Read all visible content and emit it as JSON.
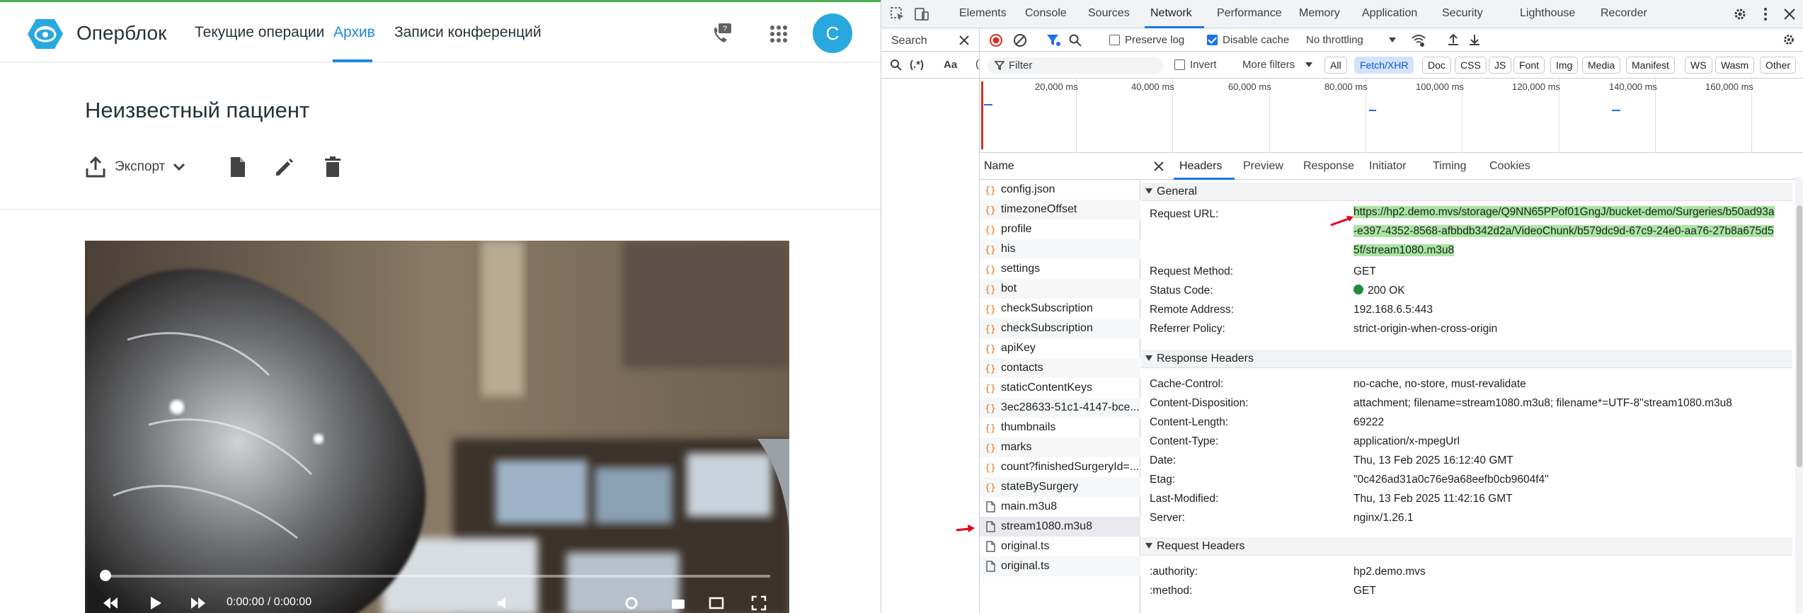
{
  "app": {
    "brand": "Оперблок",
    "nav": [
      "Текущие операции",
      "Архив",
      "Записи конференций"
    ],
    "active_nav": "Архив",
    "avatar_letter": "С",
    "page_title": "Неизвестный пациент",
    "toolbar": {
      "export_label": "Экспорт"
    },
    "video": {
      "time_label": "0:00:00 / 0:00:00"
    }
  },
  "devtools": {
    "tabs": [
      "Elements",
      "Console",
      "Sources",
      "Network",
      "Performance",
      "Memory",
      "Application",
      "Security",
      "Lighthouse",
      "Recorder"
    ],
    "active_tab": "Network",
    "search_label": "Search",
    "preserve_log": "Preserve log",
    "disable_cache": "Disable cache",
    "throttling": "No throttling",
    "filter_placeholder": "Filter",
    "invert": "Invert",
    "more_filters": "More filters",
    "regex_label": "(.*)",
    "case_label": "Aa",
    "type_filters": [
      "All",
      "Fetch/XHR",
      "Doc",
      "CSS",
      "JS",
      "Font",
      "Img",
      "Media",
      "Manifest",
      "WS",
      "Wasm",
      "Other"
    ],
    "active_type_filter": "Fetch/XHR",
    "timeline_labels": [
      "20,000 ms",
      "40,000 ms",
      "60,000 ms",
      "80,000 ms",
      "100,000 ms",
      "120,000 ms",
      "140,000 ms",
      "160,000 ms"
    ],
    "name_header": "Name",
    "requests": [
      {
        "name": "config.json",
        "kind": "xhr"
      },
      {
        "name": "timezoneOffset",
        "kind": "xhr"
      },
      {
        "name": "profile",
        "kind": "xhr"
      },
      {
        "name": "his",
        "kind": "xhr"
      },
      {
        "name": "settings",
        "kind": "xhr"
      },
      {
        "name": "bot",
        "kind": "xhr"
      },
      {
        "name": "checkSubscription",
        "kind": "xhr"
      },
      {
        "name": "checkSubscription",
        "kind": "xhr"
      },
      {
        "name": "apiKey",
        "kind": "xhr"
      },
      {
        "name": "contacts",
        "kind": "xhr"
      },
      {
        "name": "staticContentKeys",
        "kind": "xhr"
      },
      {
        "name": "3ec28633-51c1-4147-bce...",
        "kind": "xhr"
      },
      {
        "name": "thumbnails",
        "kind": "xhr"
      },
      {
        "name": "marks",
        "kind": "xhr"
      },
      {
        "name": "count?finishedSurgeryId=...",
        "kind": "xhr"
      },
      {
        "name": "stateBySurgery",
        "kind": "xhr"
      },
      {
        "name": "main.m3u8",
        "kind": "doc"
      },
      {
        "name": "stream1080.m3u8",
        "kind": "doc"
      },
      {
        "name": "original.ts",
        "kind": "doc"
      },
      {
        "name": "original.ts",
        "kind": "doc"
      }
    ],
    "selected_request": "stream1080.m3u8",
    "detail_tabs": [
      "Headers",
      "Preview",
      "Response",
      "Initiator",
      "Timing",
      "Cookies"
    ],
    "active_detail_tab": "Headers",
    "general": {
      "title": "General",
      "request_url_key": "Request URL:",
      "request_url_lines": [
        "https://hp2.demo.mvs/storage/Q9NN65PPof01GngJ/bucket-demo/Surgeries/b50ad93a",
        "-e397-4352-8568-afbbdb342d2a/VideoChunk/b579dc9d-67c9-24e0-aa76-27b8a675d5",
        "5f/stream1080.m3u8"
      ],
      "rows": [
        {
          "k": "Request Method:",
          "v": "GET"
        },
        {
          "k": "Status Code:",
          "v": "200 OK"
        },
        {
          "k": "Remote Address:",
          "v": "192.168.6.5:443"
        },
        {
          "k": "Referrer Policy:",
          "v": "strict-origin-when-cross-origin"
        }
      ]
    },
    "response_headers": {
      "title": "Response Headers",
      "rows": [
        {
          "k": "Cache-Control:",
          "v": "no-cache, no-store, must-revalidate"
        },
        {
          "k": "Content-Disposition:",
          "v": "attachment; filename=stream1080.m3u8; filename*=UTF-8''stream1080.m3u8"
        },
        {
          "k": "Content-Length:",
          "v": "69222"
        },
        {
          "k": "Content-Type:",
          "v": "application/x-mpegUrl"
        },
        {
          "k": "Date:",
          "v": "Thu, 13 Feb 2025 16:12:40 GMT"
        },
        {
          "k": "Etag:",
          "v": "\"0c426ad31a0c76e9a68eefb0cb9604f4\""
        },
        {
          "k": "Last-Modified:",
          "v": "Thu, 13 Feb 2025 11:42:16 GMT"
        },
        {
          "k": "Server:",
          "v": "nginx/1.26.1"
        }
      ]
    },
    "request_headers": {
      "title": "Request Headers",
      "rows": [
        {
          "k": ":authority:",
          "v": "hp2.demo.mvs"
        },
        {
          "k": ":method:",
          "v": "GET"
        }
      ]
    }
  },
  "colors": {
    "accent_blue": "#1e88e5",
    "devtools_blue": "#1a73e8",
    "url_highlight": "#a8e6a1",
    "annotation_arrow": "#e0001a",
    "status_green": "#1e8e3e"
  }
}
